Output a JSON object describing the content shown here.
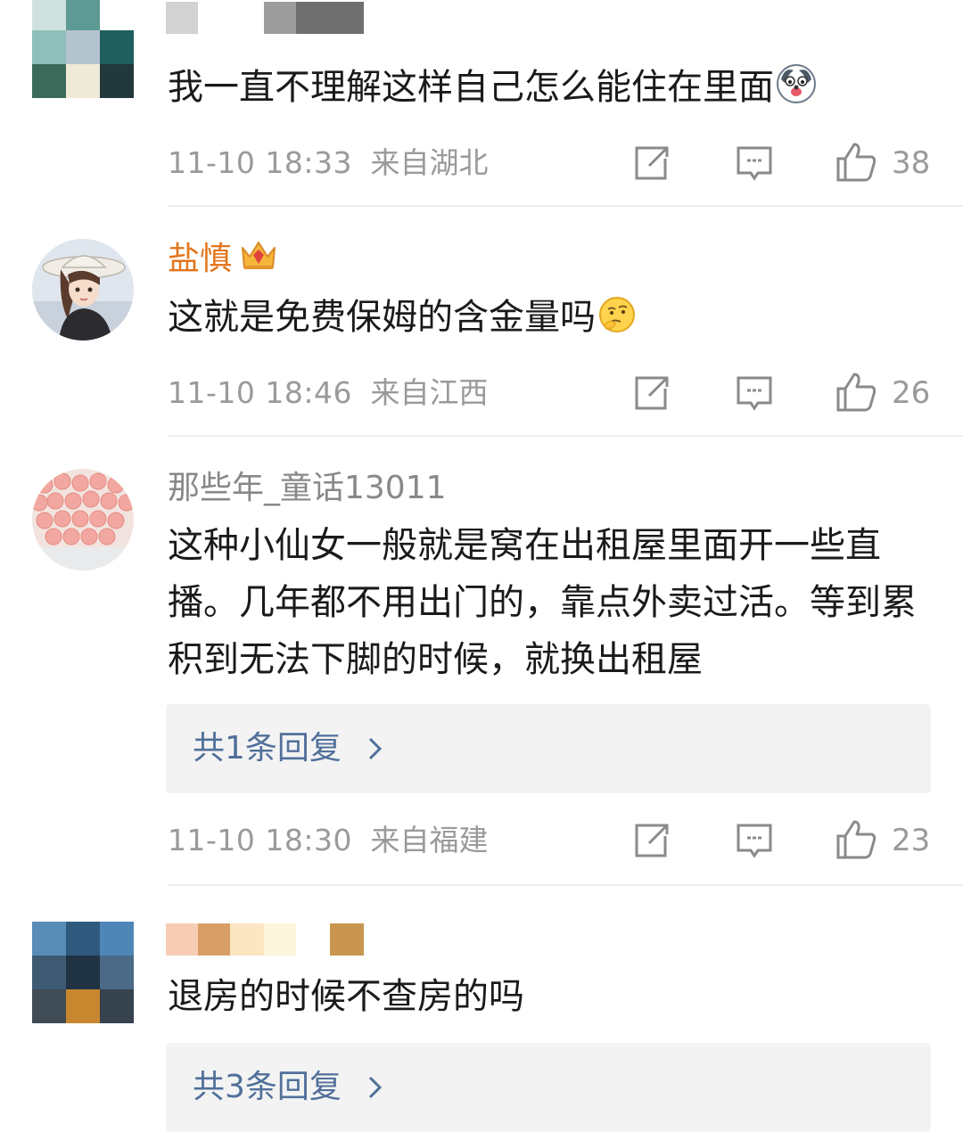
{
  "comments": [
    {
      "username": "",
      "text": "我一直不理解这样自己怎么能住在里面",
      "time": "11-10 18:33",
      "location": "来自湖北",
      "likes": "38"
    },
    {
      "username": "盐慎",
      "text": "这就是免费保姆的含金量吗",
      "time": "11-10 18:46",
      "location": "来自江西",
      "likes": "26"
    },
    {
      "username": "那些年_童话13011",
      "text": "这种小仙女一般就是窝在出租屋里面开一些直播。几年都不用出门的，靠点外卖过活。等到累积到无法下脚的时候，就换出租屋",
      "replies": "共1条回复",
      "time": "11-10 18:30",
      "location": "来自福建",
      "likes": "23"
    },
    {
      "username": "",
      "text": "退房的时候不查房的吗",
      "replies": "共3条回复"
    }
  ],
  "colors": {
    "vip_name": "#e3761c",
    "reply_link": "#51709a",
    "meta_gray": "#9a9a9a"
  }
}
